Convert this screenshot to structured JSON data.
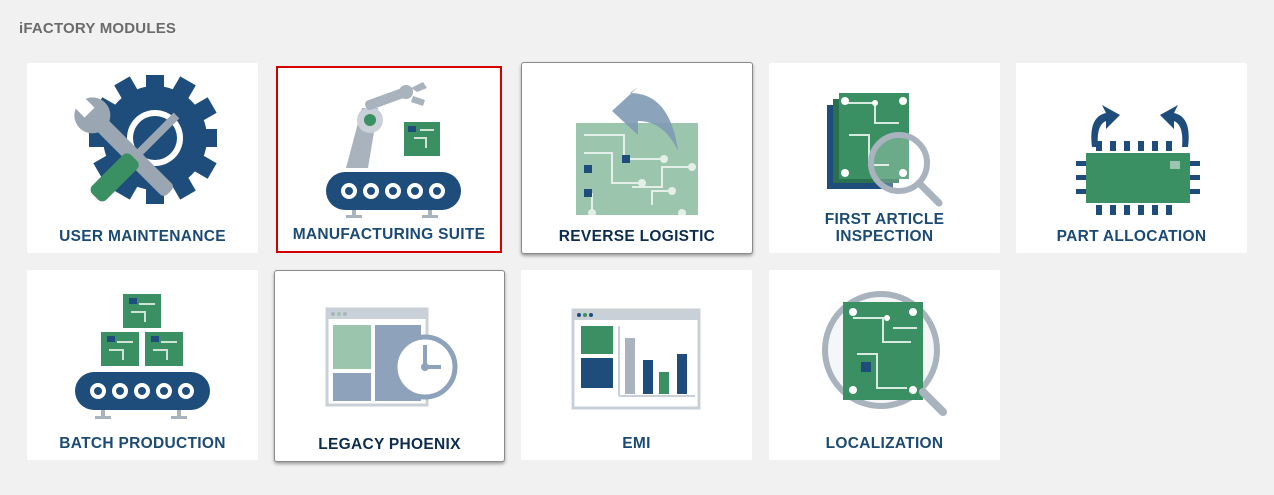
{
  "page": {
    "section_title": "iFACTORY MODULES"
  },
  "modules": [
    {
      "label": "USER MAINTENANCE",
      "icon": "gear-wrench-screwdriver-icon"
    },
    {
      "label": "MANUFACTURING SUITE",
      "icon": "robot-arm-conveyor-icon"
    },
    {
      "label": "REVERSE LOGISTIC",
      "icon": "circuit-board-return-arrow-icon"
    },
    {
      "label_line1": "FIRST ARTICLE",
      "label_line2": "INSPECTION",
      "icon": "circuit-board-magnifier-icon"
    },
    {
      "label": "PART ALLOCATION",
      "icon": "chip-arrows-icon"
    },
    {
      "label": "BATCH PRODUCTION",
      "icon": "stacked-boards-conveyor-icon"
    },
    {
      "label": "LEGACY PHOENIX",
      "icon": "window-clock-icon"
    },
    {
      "label": "EMI",
      "icon": "window-bar-chart-icon"
    },
    {
      "label": "LOCALIZATION",
      "icon": "magnified-circuit-board-icon"
    }
  ],
  "colors": {
    "navy": "#1e4d7b",
    "green": "#3a8f63",
    "light_green": "#9cc5ad",
    "grey": "#a9b3be",
    "selected_border": "#d40000"
  }
}
